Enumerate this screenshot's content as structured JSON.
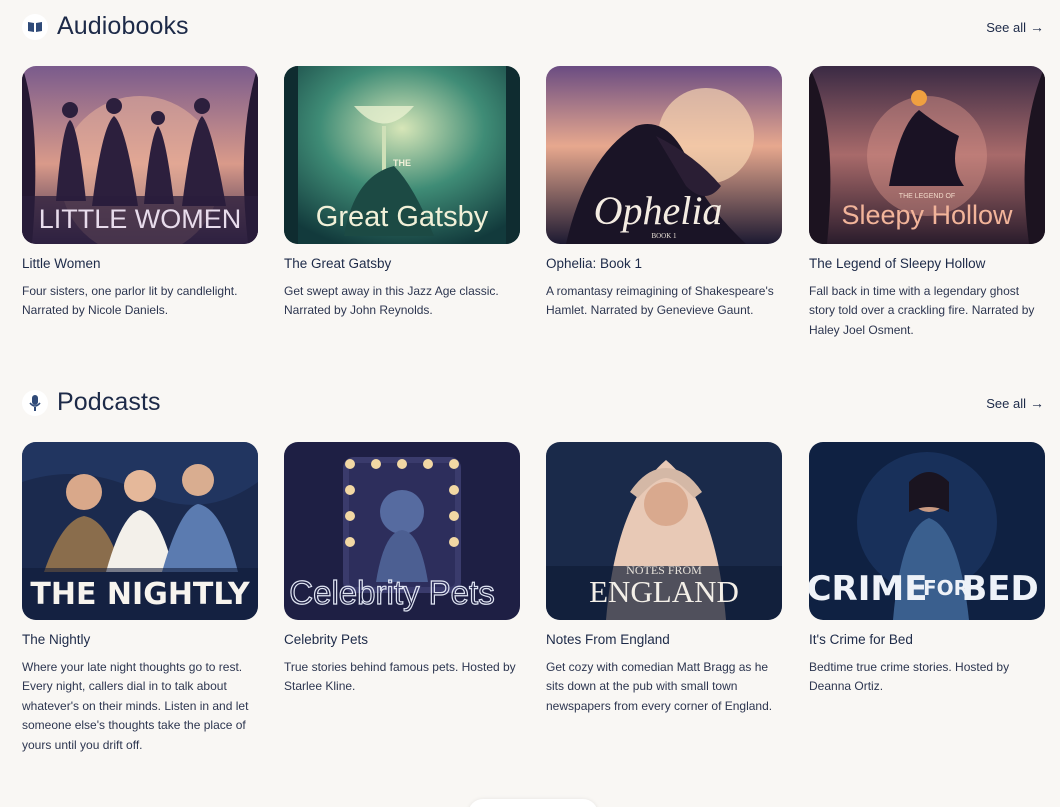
{
  "audiobooks": {
    "title": "Audiobooks",
    "icon": "book-icon",
    "see_all": "See all",
    "items": [
      {
        "title": "Little Women",
        "desc": "Four sisters, one parlor lit by candlelight. Narrated by Nicole Daniels.",
        "cover_text": "LITTLE WOMEN"
      },
      {
        "title": "The Great Gatsby",
        "desc": "Get swept away in this Jazz Age classic. Narrated by John Reynolds.",
        "cover_small": "THE",
        "cover_text": "Great Gatsby"
      },
      {
        "title": "Ophelia: Book 1",
        "desc": "A romantasy reimagining of Shakespeare's Hamlet. Narrated by Genevieve Gaunt.",
        "cover_text": "Ophelia",
        "cover_small": "BOOK 1"
      },
      {
        "title": "The Legend of Sleepy Hollow",
        "desc": "Fall back in time with a legendary ghost story told over a crackling fire. Narrated by Haley Joel Osment.",
        "cover_small": "THE LEGEND OF",
        "cover_text": "Sleepy Hollow"
      }
    ]
  },
  "podcasts": {
    "title": "Podcasts",
    "icon": "microphone-icon",
    "see_all": "See all",
    "items": [
      {
        "title": "The Nightly",
        "desc": "Where your late night thoughts go to rest. Every night, callers dial in to talk about whatever's on their minds. Listen in and let someone else's thoughts take the place of yours until you drift off.",
        "cover_text": "THE NIGHTLY"
      },
      {
        "title": "Celebrity Pets",
        "desc": "True stories behind famous pets. Hosted by Starlee Kline.",
        "cover_text": "Celebrity Pets"
      },
      {
        "title": "Notes From England",
        "desc": "Get cozy with comedian Matt Bragg as he sits down at the pub with small town newspapers from every corner of England.",
        "cover_small": "NOTES FROM",
        "cover_text": "ENGLAND"
      },
      {
        "title": "It's Crime for Bed",
        "desc": "Bedtime true crime stories. Hosted by Deanna Ortiz.",
        "cover_text_a": "CRIME",
        "cover_text_b": "FOR",
        "cover_text_c": "BED"
      }
    ]
  },
  "colors": {
    "background": "#f9f7f4",
    "text": "#1d2a48",
    "icon": "#2f4a78"
  }
}
